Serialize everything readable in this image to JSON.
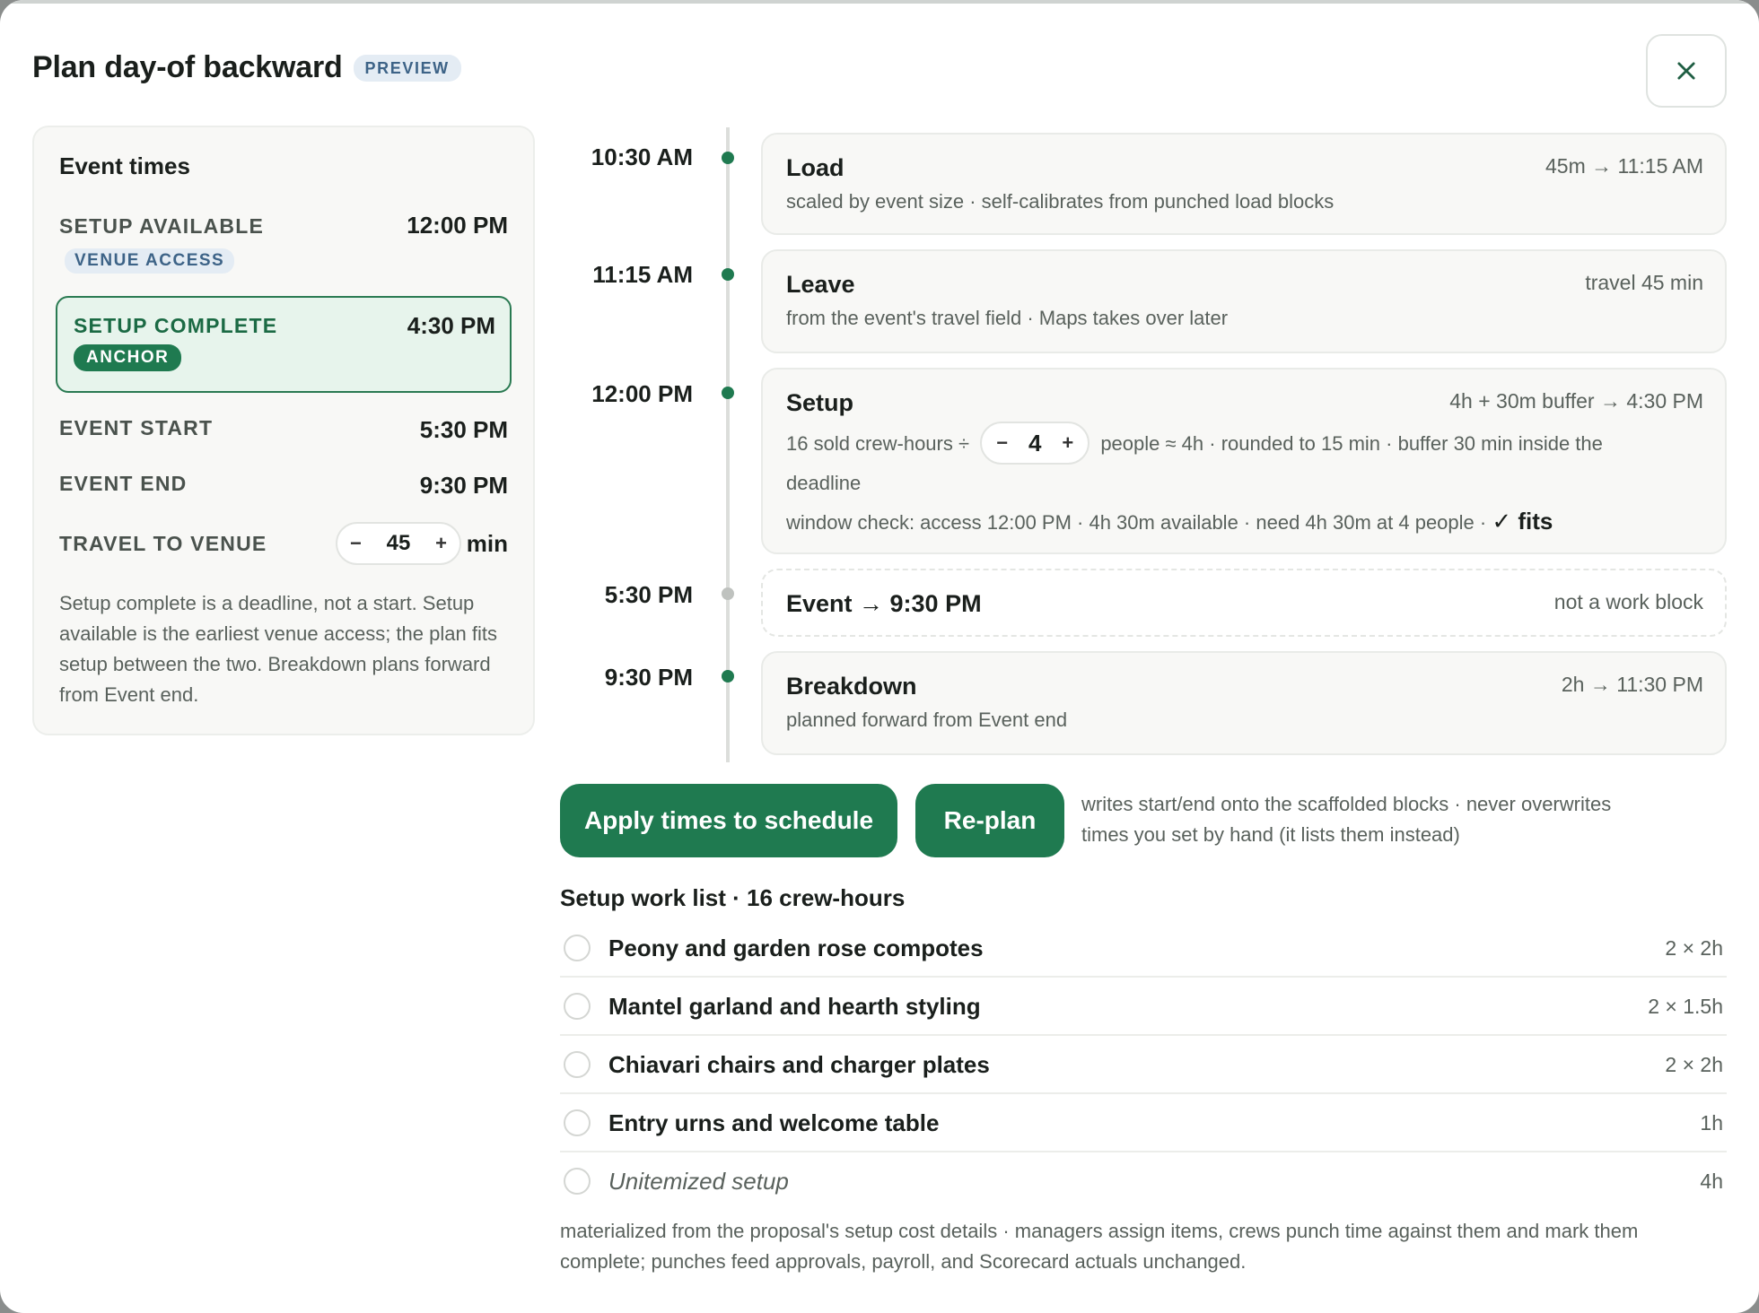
{
  "header": {
    "title": "Plan day-of backward",
    "badge": "PREVIEW",
    "close_icon": "close-icon"
  },
  "event_times": {
    "heading": "Event times",
    "setup_available": {
      "label": "SETUP AVAILABLE",
      "chip": "VENUE ACCESS",
      "value": "12:00 PM"
    },
    "setup_complete": {
      "label": "SETUP COMPLETE",
      "chip": "ANCHOR",
      "value": "4:30 PM"
    },
    "event_start": {
      "label": "EVENT START",
      "value": "5:30 PM"
    },
    "event_end": {
      "label": "EVENT END",
      "value": "9:30 PM"
    },
    "travel": {
      "label": "TRAVEL TO VENUE",
      "minus": "−",
      "value": "45",
      "plus": "+",
      "unit": "min"
    },
    "note": "Setup complete is a deadline, not a start. Setup available is the earliest venue access; the plan fits setup between the two. Breakdown plans forward from Event end."
  },
  "timeline": {
    "load": {
      "time": "10:30 AM",
      "name": "Load",
      "meta": "45m → 11:15 AM",
      "desc": "scaled by event size · self-calibrates from punched load blocks"
    },
    "leave": {
      "time": "11:15 AM",
      "name": "Leave",
      "meta": "travel 45 min",
      "desc": "from the event's travel field · Maps takes over later"
    },
    "setup": {
      "time": "12:00 PM",
      "name": "Setup",
      "meta": "4h + 30m buffer → 4:30 PM",
      "desc_prefix": "16 sold crew-hours ÷",
      "people": {
        "minus": "−",
        "value": "4",
        "plus": "+"
      },
      "desc_suffix": "people ≈ 4h · rounded to 15 min · buffer 30 min inside the deadline",
      "check": "window check: access 12:00 PM · 4h 30m available · need 4h 30m at 4 people ·",
      "check_result": "✓ fits"
    },
    "event": {
      "time": "5:30 PM",
      "name": "Event → 9:30 PM",
      "meta": "not a work block"
    },
    "breakdown": {
      "time": "9:30 PM",
      "name": "Breakdown",
      "meta": "2h → 11:30 PM",
      "desc": "planned forward from Event end"
    }
  },
  "actions": {
    "apply_label": "Apply times to schedule",
    "replan_label": "Re-plan",
    "note": "writes start/end onto the scaffolded blocks · never overwrites times you set by hand (it lists them instead)"
  },
  "work_list": {
    "title": "Setup work list · 16 crew-hours",
    "items": [
      {
        "name": "Peony and garden rose compotes",
        "duration": "2 × 2h"
      },
      {
        "name": "Mantel garland and hearth styling",
        "duration": "2 × 1.5h"
      },
      {
        "name": "Chiavari chairs and charger plates",
        "duration": "2 × 2h"
      },
      {
        "name": "Entry urns and welcome table",
        "duration": "1h"
      },
      {
        "name": "Unitemized setup",
        "duration": "4h"
      }
    ],
    "note": "materialized from the proposal's setup cost details · managers assign items, crews punch time against them and mark them complete; punches feed approvals, payroll, and Scorecard actuals unchanged."
  },
  "colors": {
    "accent": "#1f7a50",
    "anchor_bg": "#e7f4ec",
    "chip_blue_bg": "#e4ecf4",
    "chip_blue_text": "#3d6387"
  }
}
